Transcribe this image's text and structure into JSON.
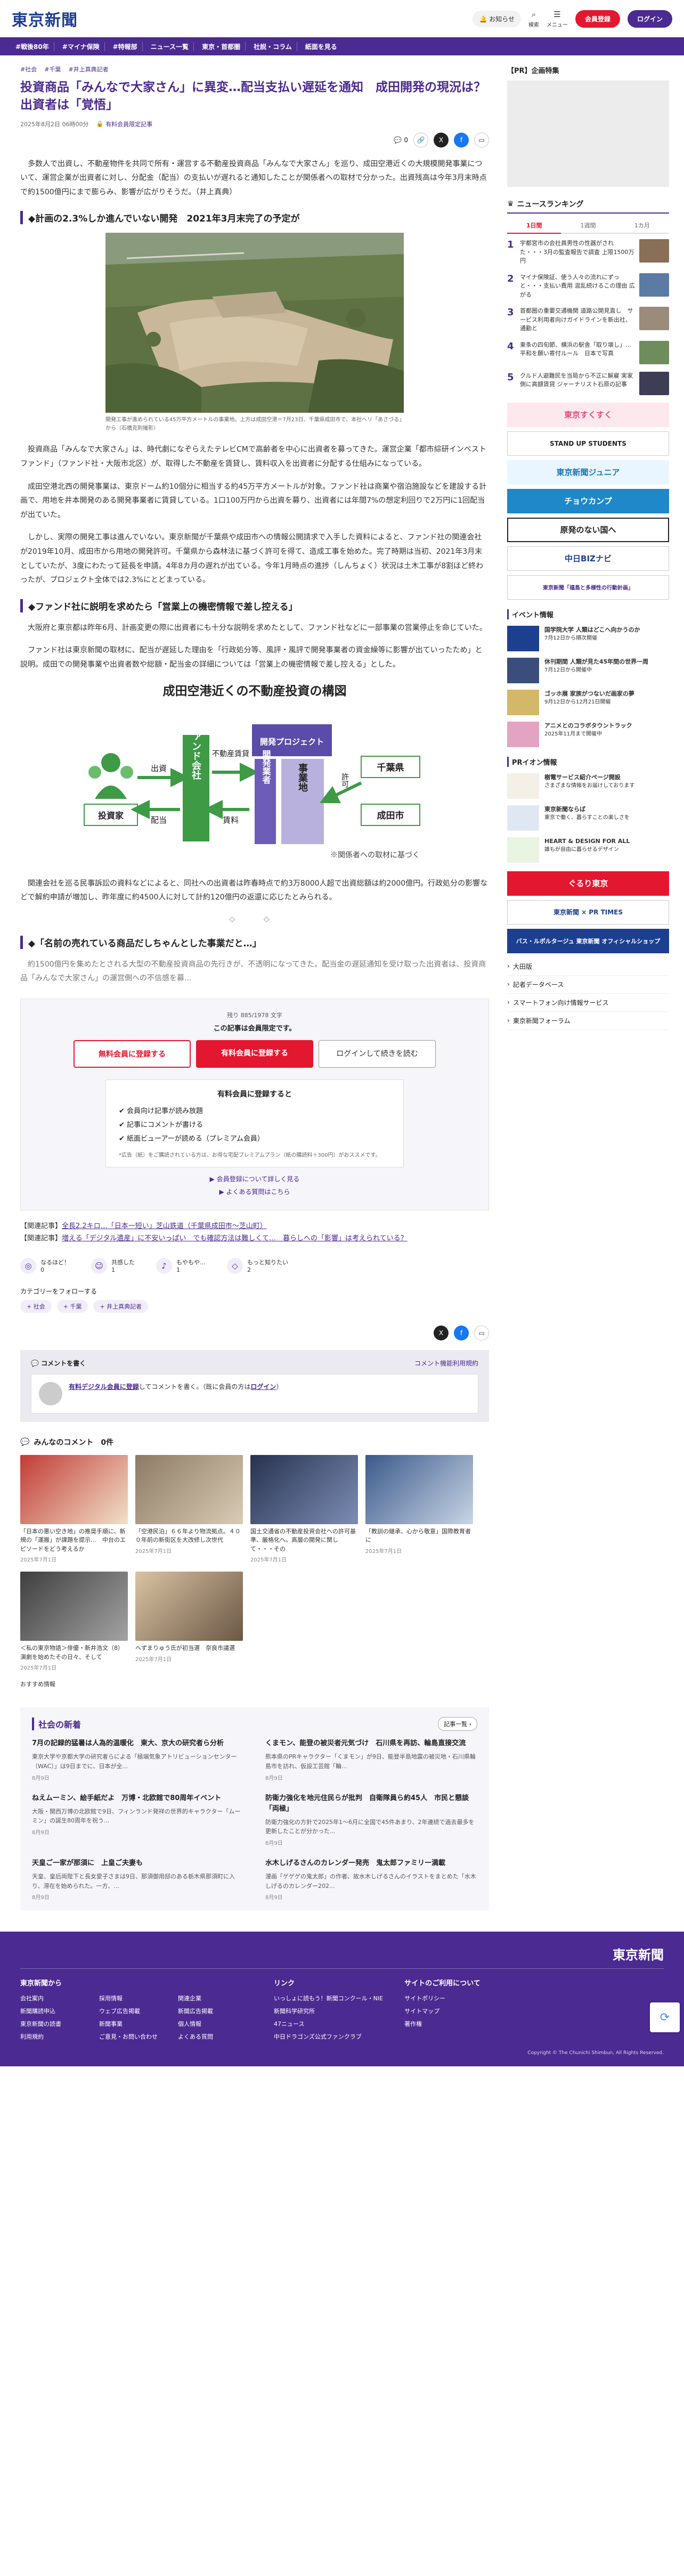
{
  "header": {
    "logo": "東京新聞",
    "bell_label": "お知らせ",
    "search_label": "検索",
    "menu_label": "メニュー",
    "signup": "会員登録",
    "login": "ログイン"
  },
  "gnav": [
    "#戦後80年",
    "#マイナ保険",
    "#特報部",
    "ニュース一覧",
    "東京・首都圏",
    "社説・コラム",
    "紙面を見る"
  ],
  "article": {
    "crumbs": [
      "#社会",
      "#千葉",
      "#井上真典記者"
    ],
    "title": "投資商品「みんなで大家さん」に異変…配当支払い遅延を通知　成田開発の現況は？　出資者は「覚悟」",
    "date": "2025年8月2日 06時00分",
    "paid": "有料会員限定記事",
    "comment_count": "0",
    "lead": "多数人で出資し、不動産物件を共同で所有・運営する不動産投資商品「みんなで大家さん」を巡り、成田空港近くの大規模開発事業について、運営企業が出資者に対し、分配金（配当）の支払いが遅れると通知したことが関係者への取材で分かった。出資残高は今年3月末時点で約1500億円にまで膨らみ、影響が広がりそうだ。（井上真典）",
    "h_plan": "◆計画の2.3%しか進んでいない開発　2021年3月末完了の予定が",
    "photo_caption": "開発工事が進められている45万平方メートルの事業地。上方は成田空港＝7月23日、千葉県成田市で、本社ヘリ「あさづる」から（石橋克則撮影）",
    "p1": "投資商品「みんなで大家さん」は、時代劇になぞらえたテレビCMで高齢者を中心に出資者を募ってきた。運営企業「都市綜研インベストファンド」（ファンド社・大阪市北区）が、取得した不動産を賃貸し、賃料収入を出資者に分配する仕組みになっている。",
    "p2": "成田空港北西の開発事業は、東京ドーム約10個分に相当する約45万平方メートルが対象。ファンド社は商業や宿泊施設などを建設する計画で、用地を井本開発のある開発事業者に賃貸している。1口100万円から出資を募り、出資者には年間7%の想定利回りで2万円に1回配当が出ていた。",
    "p3": "しかし、実際の開発工事は進んでいない。東京新聞が千葉県や成田市への情報公開請求で入手した資料によると、ファンド社の関連会社が2019年10月、成田市から用地の開発許可。千葉県から森林法に基づく許可を得て、造成工事を始めた。完了時期は当初、2021年3月末としていたが、3度にわたって延長を申請。4年8カ月の遅れが出ている。今年1月時点の進捗（しんちょく）状況は土木工事が8割ほど終わったが、プロジェクト全体では2.3%にとどまっている。",
    "h_fund": "◆ファンド社に説明を求めたら「営業上の機密情報で差し控える」",
    "p4": "大阪府と東京都は昨年6月、計画変更の際に出資者にも十分な説明を求めたとして、ファンド社などに一部事業の営業停止を命じていた。",
    "p5": "ファンド社は東京新聞の取材に、配当が遅延した理由を「行政処分等、風評・風評で開発事業者の資金繰等に影響が出ていったため」と説明。成田での開発事業や出資者数や総額・配当金の詳細については「営業上の機密情報で差し控える」とした。",
    "diagram": {
      "title": "成田空港近くの不動産投資の構図",
      "investors": "投資家",
      "fund": "ファンド会社",
      "developer": "開発業者",
      "project": "開発プロジェクト",
      "land": "事業地",
      "chiba": "千葉県",
      "narita": "成田市",
      "invest": "出資",
      "dividend": "配当",
      "lease": "不動産賃貸",
      "rent": "賃料",
      "permit": "許可",
      "note": "※関係者への取材に基づく"
    },
    "p6": "関連会社を巡る民事訴訟の資料などによると、同社への出資者は昨春時点で約3万8000人超で出資総額は約2000億円。行政処分の影響などで解約申請が増加し、昨年度に約4500人に対して計約120億円の返還に応じたとみられる。",
    "stars": "◇　◇",
    "h_heard": "◆「名前の売れている商品だしちゃんとした事業だと…」",
    "p7_start": "約1500億円を集めたとされる大型の不動産投資商品の先行きが、不透明になってきた。配当金の遅延通知を受け取った出資者は、投資商品「みんなで大家さん」の運営側への不信感を募..."
  },
  "paywall": {
    "count_text": "残り 885/1978 文字",
    "msg": "この記事は会員限定です。",
    "btn_free": "無料会員に登録する",
    "btn_paid": "有料会員に登録する",
    "btn_login": "ログインして続きを読む",
    "box_title": "有料会員に登録すると",
    "benefits": [
      "会員向け記事が読み放題",
      "記事にコメントが書ける",
      "紙面ビューアーが読める（プレミアム会員）"
    ],
    "note": "*広告（紙）をご購読されている方は、お得な宅配プレミアムプラン（紙の購読料＋300円）がおススメです。",
    "link1": "会員登録について詳しく見る",
    "link2": "よくある質問はこちら"
  },
  "related": {
    "label1": "【関連記事】",
    "link1": "全長2.2キロ…「日本一短い」芝山鉄道（千葉県成田市〜芝山町）",
    "label2": "【関連記事】",
    "link2": "増える「デジタル遺産」に不安いっぱい　でも確認方法は難しくて…　暮らしへの「影響」は考えられている？"
  },
  "reactions": [
    {
      "icon": "◎",
      "label": "なるほど！",
      "count": "0"
    },
    {
      "icon": "☺",
      "label": "共感した",
      "count": "1"
    },
    {
      "icon": "♪",
      "label": "もやもや…",
      "count": "1"
    },
    {
      "icon": "◇",
      "label": "もっと知りたい",
      "count": "2"
    }
  ],
  "follow": {
    "label": "カテゴリーをフォローする",
    "tags": [
      "社会",
      "千葉",
      "井上真典記者"
    ]
  },
  "comments": {
    "head": "コメントを書く",
    "guide": "コメント機能利用規約",
    "login_hint_a": "有料デジタル会員に登録",
    "login_hint_b": "してコメントを書く。（既に会員の方は",
    "login_hint_c": "ログイン",
    "login_hint_d": "）",
    "list_head": "みんなのコメント　0件"
  },
  "related_grid": [
    {
      "text": "「日本の悪い空き地」の推奨手順に、新規の「運搬」が課題を提示…　中台のエピソードをどう考えるか",
      "date": "2025年7月1日"
    },
    {
      "text": "「空港民泊」６６年より物流拠点。４００年前の新街区を大改修し次世代",
      "date": "2025年7月1日"
    },
    {
      "text": "国土交通省の不動産投資会社への許可基準、厳格化へ。高層の開発に関して・・・その",
      "date": "2025年7月1日"
    },
    {
      "text": "「教訓の継承、心から敬意」国際教育者に",
      "date": "2025年7月1日"
    },
    {
      "text": "＜私の東京物語＞俳優・新井浩文（8）演劇を始めたその日々、そして",
      "date": "2025年7月1日"
    },
    {
      "text": "へずまりゅう氏が初当選　奈良市議選",
      "date": "2025年7月1日"
    }
  ],
  "news_panel": {
    "title": "社会の新着",
    "more": "記事一覧 ›",
    "items": [
      {
        "h": "7月の記録的猛暑は人為的温暖化　東大、京大の研究者ら分析",
        "p": "東京大学や京都大学の研究者らによる「極端気象アトリビューションセンター（WAC）」は9日までに、日本が全...",
        "dt": "8月9日"
      },
      {
        "h": "くまモン、能登の被災者元気づけ　石川県を再訪、輪島直接交流",
        "p": "熊本県のPRキャラクター「くまモン」が9日、能登半島地震の被災地・石川県輪島市を訪れ、仮設工芸館「輪...",
        "dt": "8月9日"
      },
      {
        "h": "ねえムーミン、絵手紙だよ　万博・北欧館で80周年イベント",
        "p": "大阪・関西万博の北欧館で9日、フィンランド発祥の世界的キャラクター「ムーミン」の誕生80周年を祝う...",
        "dt": "8月9日"
      },
      {
        "h": "防衛力強化を地元住民らが批判　自衛隊員ら約45人　市民と懇談「両極」",
        "p": "防衛力強化の方針で2025年1〜6月に全国で45件あまり、2年連続で過去最多を更新したことが分かった...",
        "dt": "8月9日"
      },
      {
        "h": "天皇ご一家が那須に　上皇ご夫妻も",
        "p": "天皇、皇后両陛下と長女愛子さまは9日、那須御用邸のある栃木県那須町に入り、滞在を始められた。一方、...",
        "dt": "8月9日"
      },
      {
        "h": "水木しげるさんのカレンダー発売　鬼太郎ファミリー満載",
        "p": "漫画「ゲゲゲの鬼太郎」の作者、故水木しげるさんのイラストをまとめた「水木しげるのカレンダー202...",
        "dt": "8月9日"
      }
    ],
    "osusume": "おすすめ情報"
  },
  "sidebar": {
    "pr_head": "【PR】企画特集",
    "rank_head": "ニュースランキング",
    "rank_tabs": [
      "1日間",
      "1週間",
      "1カ月"
    ],
    "rank": [
      "宇都宮市の会社員男性の性器がされた・・・3月の監査報告で調査 上限1500万円",
      "マイナ保険証、使う人々の流れにずっと・・・支払い費用 混乱続けるこの理由 広がる",
      "首都圏の重要交通機関 道路公開見直し　サービス利用者向けガイドラインを新出社、通勤と",
      "東条の四旬節、横浜の駅舎「取り壊し」…平和を願い寄付ルール　日本で写真",
      "クルド人避難民を当局から不正に解雇 実家側に高額賃貸 ジャーナリスト石原の記事"
    ],
    "banners": [
      "東京すくすく",
      "STAND UP STUDENTS",
      "東京新聞ジュニア",
      "チョウカンプ",
      "原発のない国へ",
      "中日BIZナビ",
      "東京新聞「福島と多様性の行動計画」"
    ],
    "ev_head": "イベント情報",
    "events": [
      {
        "t": "国学院大学 人類はどこへ向かうのか",
        "d": "7月12日から順次開催"
      },
      {
        "t": "休刊期間 人類が見た45年間の世界一周",
        "d": "7月12日から開催中"
      },
      {
        "t": "ゴッホ展 家族がつないだ画家の夢",
        "d": "9月12日から12月21日開催"
      },
      {
        "t": "アニメとのコラボタウントラック",
        "d": "2025年11月まで開催中"
      }
    ],
    "pr_info_head": "PRイオン情報",
    "pr_info": [
      {
        "t": "樹電サービス紹介ページ開設",
        "d": "さまざまな情報をお届けしております"
      },
      {
        "t": "東京新聞ならば",
        "d": "東京で働く、暮らすことの楽しさを"
      },
      {
        "t": "HEART & DESIGN FOR ALL",
        "d": "誰もが自由に暮らせるデザイン"
      }
    ],
    "links": [
      "大田版",
      "記者データベース",
      "スマートフォン向け情報サービス",
      "東京新聞フォーラム"
    ],
    "banner2": [
      "ぐるり東京",
      "東京新聞 × PR TIMES",
      "バス・ルポルタージュ 東京新聞 オフィシャルショップ"
    ]
  },
  "footer": {
    "logo": "東京新聞",
    "col1_head": "東京新聞から",
    "col1": [
      "会社案内",
      "採用情報",
      "関連企業",
      "新聞購読申込",
      "ウェブ広告掲載",
      "新聞広告掲載",
      "東京新聞の読書",
      "新聞事業",
      "個人情報",
      "利用規約",
      "ご意見・お問い合わせ",
      "よくある質問"
    ],
    "col2_head": "リンク",
    "col2": [
      "いっしょに読もう！新聞コンクール・NIE",
      "新聞科学研究所",
      "47ニュース",
      "中日ドラゴンズ公式ファンクラブ"
    ],
    "col3_head": "サイトのご利用について",
    "col3": [
      "サイトポリシー",
      "サイトマップ",
      "著作権"
    ],
    "copy": "Copyright © The Chunichi Shimbun, All Rights Reserved."
  }
}
